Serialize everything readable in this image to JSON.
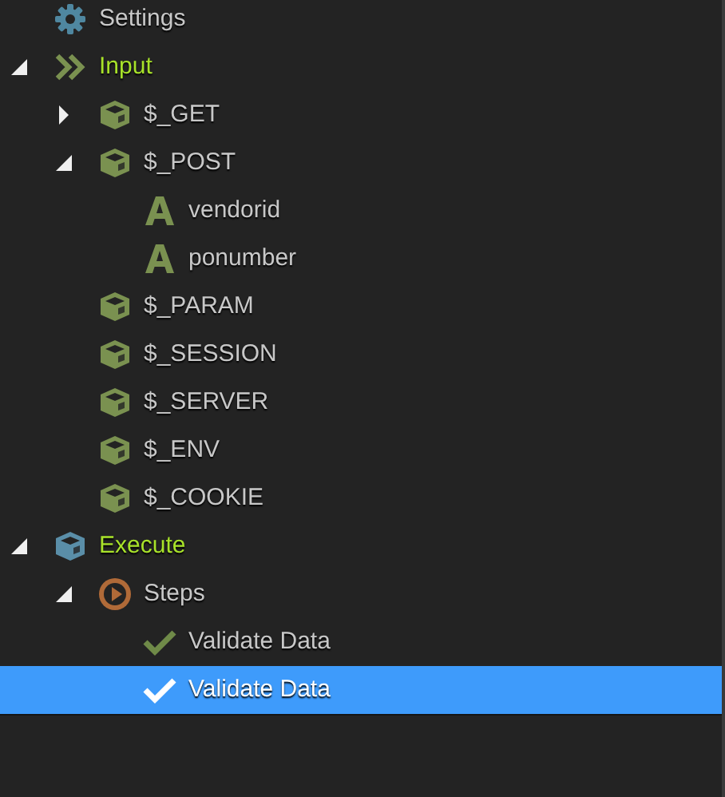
{
  "tree": [
    {
      "label": "Settings",
      "kind": "gear",
      "color": "#4f87a0",
      "emphasized": false,
      "selected": false
    },
    {
      "label": "Input",
      "kind": "chevrons",
      "color": "#7a9150",
      "emphasized": true,
      "selected": false,
      "expanded": true,
      "children": [
        {
          "label": "$_GET",
          "kind": "cube",
          "color": "#7a9150",
          "emphasized": false,
          "selected": false,
          "expanded": false
        },
        {
          "label": "$_POST",
          "kind": "cube",
          "color": "#7a9150",
          "emphasized": false,
          "selected": false,
          "expanded": true,
          "children": [
            {
              "label": "vendorid",
              "kind": "letter",
              "color": "#7a9150",
              "emphasized": false,
              "selected": false
            },
            {
              "label": "ponumber",
              "kind": "letter",
              "color": "#7a9150",
              "emphasized": false,
              "selected": false
            }
          ]
        },
        {
          "label": "$_PARAM",
          "kind": "cube",
          "color": "#7a9150",
          "emphasized": false,
          "selected": false
        },
        {
          "label": "$_SESSION",
          "kind": "cube",
          "color": "#7a9150",
          "emphasized": false,
          "selected": false
        },
        {
          "label": "$_SERVER",
          "kind": "cube",
          "color": "#7a9150",
          "emphasized": false,
          "selected": false
        },
        {
          "label": "$_ENV",
          "kind": "cube",
          "color": "#7a9150",
          "emphasized": false,
          "selected": false
        },
        {
          "label": "$_COOKIE",
          "kind": "cube",
          "color": "#7a9150",
          "emphasized": false,
          "selected": false
        }
      ]
    },
    {
      "label": "Execute",
      "kind": "cube",
      "color": "#5a8ea8",
      "emphasized": true,
      "selected": false,
      "expanded": true,
      "children": [
        {
          "label": "Steps",
          "kind": "play",
          "color": "#b06a38",
          "emphasized": false,
          "selected": false,
          "expanded": true,
          "children": [
            {
              "label": "Validate Data",
              "kind": "check",
              "color": "#6f8a48",
              "emphasized": false,
              "selected": false
            },
            {
              "label": "Validate Data",
              "kind": "check",
              "emphasized": false,
              "selected": true
            }
          ]
        }
      ]
    }
  ]
}
